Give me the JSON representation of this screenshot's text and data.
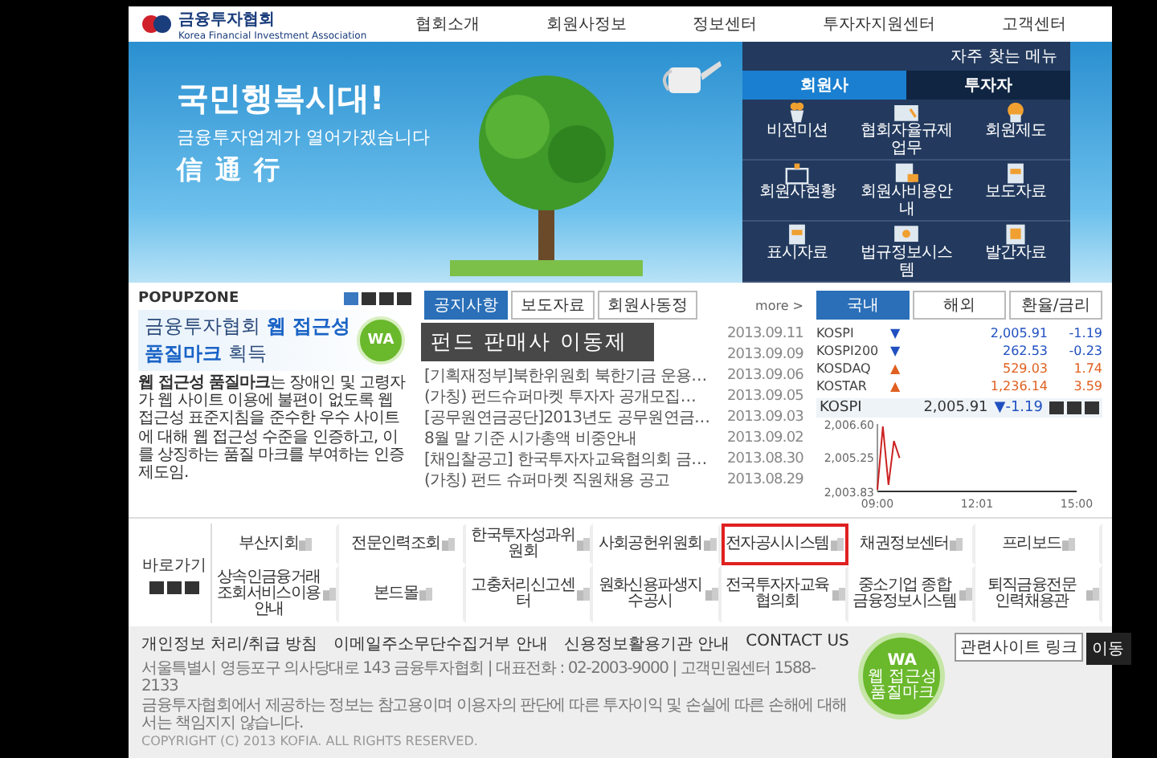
{
  "header": {
    "logo": {
      "name": "금융투자협회",
      "subtitle": "Korea Financial Investment Association"
    },
    "nav": [
      "협회소개",
      "회원사정보",
      "정보센터",
      "투자자지원센터",
      "고객센터"
    ]
  },
  "banner": {
    "headline": "국민행복시대!",
    "subhead": "금융투자업계가 열어가겠습니다",
    "values": [
      "信",
      "通",
      "行"
    ],
    "quick_menu": {
      "title": "자주 찾는 메뉴",
      "tabs": [
        {
          "label": "회원사",
          "selected": true
        },
        {
          "label": "투자자",
          "selected": false
        }
      ],
      "items": [
        {
          "label": "비전미션",
          "kind": "pot"
        },
        {
          "label": "협회자율규제업무",
          "kind": "book"
        },
        {
          "label": "회원제도",
          "kind": "badge"
        },
        {
          "label": "회원사현황",
          "kind": "box"
        },
        {
          "label": "회원사비용안내",
          "kind": "news"
        },
        {
          "label": "보도자료",
          "kind": "file"
        },
        {
          "label": "표시자료",
          "kind": "file"
        },
        {
          "label": "법규정보시스템",
          "kind": "screen"
        },
        {
          "label": "발간자료",
          "kind": "frame"
        }
      ]
    }
  },
  "popup_zone": {
    "title": "POPUPZONE",
    "headline": [
      "금융투자협회 **웹 접근성**",
      "**품질마크** 획득"
    ],
    "badge": "WA",
    "text": "**웹 접근성 품질마크**는 장애인 및 고령자가 웹 사이트 이용에 불편이 없도록 웹 접근성 표준지침을 준수한 우수 사이트에 대해 웹 접근성 수준을 인증하고, 이를 상징하는 품질 마크를 부여하는 인증제도임."
  },
  "notices": {
    "tabs": [
      {
        "label": "공지사항",
        "selected": true
      },
      {
        "label": "보도자료",
        "selected": false
      },
      {
        "label": "회원사동정",
        "selected": false
      }
    ],
    "more": "more >",
    "caption": "펀드 판매사 이동제",
    "items": [
      {
        "date": "2013.09.11"
      },
      {
        "date": "2013.09.09"
      },
      {
        "title": "[기획재정부]북한위원회 북한기금 운용…",
        "date": "2013.09.06"
      },
      {
        "title": "(가칭) 펀드슈퍼마켓 투자자 공개모집…",
        "date": "2013.09.05"
      },
      {
        "title": "[공무원연금공단]2013년도 공무원연금…",
        "date": "2013.09.03"
      },
      {
        "title": "8월 말 기준 시가총액 비중안내",
        "date": "2013.09.02"
      },
      {
        "title": "[채입찰공고] 한국투자자교육협의회 금…",
        "date": "2013.08.30"
      },
      {
        "title": "(가칭) 펀드 슈퍼마켓 직원채용 공고",
        "date": "2013.08.29"
      }
    ]
  },
  "market": {
    "tabs": [
      {
        "label": "국내",
        "selected": true
      },
      {
        "label": "해외",
        "selected": false
      },
      {
        "label": "환율/금리",
        "selected": false
      }
    ],
    "indices": [
      {
        "name": "KOSPI",
        "arrow": "▼",
        "color": "#2050c0",
        "value": "2,005.91",
        "change": "-1.19"
      },
      {
        "name": "KOSPI200",
        "arrow": "▼",
        "color": "#2050c0",
        "value": "262.53",
        "change": "-0.23"
      },
      {
        "name": "KOSDAQ",
        "arrow": "▲",
        "color": "#e06020",
        "value": "529.03",
        "change": "1.74"
      },
      {
        "name": "KOSTAR",
        "arrow": "▲",
        "color": "#e06020",
        "value": "1,236.14",
        "change": "3.59"
      }
    ],
    "chart_value": "2,005.91",
    "chart_change": "▼-1.19",
    "chart_data": {
      "type": "line",
      "title": "KOSPI",
      "categories": [
        "09:00",
        null,
        null,
        null,
        null,
        null,
        null,
        null,
        null,
        null,
        null,
        null,
        null,
        null,
        null,
        null,
        null,
        null,
        "12:01",
        null,
        null,
        null,
        null,
        null,
        null,
        null,
        null,
        null,
        null,
        null,
        null,
        null,
        null,
        null,
        null,
        null,
        "15:00"
      ],
      "ylim": [
        2003.83,
        2006.6
      ],
      "yticks": [
        {
          "value": 2003.83,
          "label": "2,003.83"
        },
        {
          "value": 2005.25,
          "label": "2,005.25"
        },
        {
          "value": 2006.6,
          "label": "2,006.60"
        }
      ],
      "series": [
        {
          "color": "#cc2222",
          "values": [
            2003.9,
            2006.5,
            2004.1,
            2005.9,
            2005.2,
            null,
            null,
            null,
            null,
            null,
            null,
            null,
            null,
            null,
            null,
            null,
            null,
            null,
            null,
            null,
            null,
            null,
            null,
            null,
            null,
            null,
            null,
            null,
            null,
            null,
            null,
            null,
            null,
            null,
            null,
            null,
            null
          ]
        }
      ]
    }
  },
  "quick_links": {
    "title": "바로가기",
    "items": [
      {
        "label": "부산지회",
        "highlighted": false
      },
      {
        "label": "전문인력조회",
        "highlighted": false
      },
      {
        "label": "한국투자성과위원회",
        "highlighted": false
      },
      {
        "label": "사회공헌위원회",
        "highlighted": false
      },
      {
        "label": "전자공시시스템",
        "highlighted": true
      },
      {
        "label": "채권정보센터",
        "highlighted": false
      },
      {
        "label": "프리보드",
        "highlighted": false
      },
      {
        "label": "상속인금융거래 조회서비스이용안내",
        "highlighted": false
      },
      {
        "label": "본드몰",
        "highlighted": false
      },
      {
        "label": "고충처리신고센터",
        "highlighted": false
      },
      {
        "label": "원화신용파생지수공시",
        "highlighted": false
      },
      {
        "label": "전국투자자교육협의회",
        "highlighted": false
      },
      {
        "label": "중소기업 종합 금융정보시스템",
        "highlighted": false
      },
      {
        "label": "퇴직금융전문 인력채용관",
        "highlighted": false
      }
    ]
  },
  "footer": {
    "links": [
      "개인정보 처리/취급 방침",
      "이메일주소무단수집거부 안내",
      "신용정보활용기관 안내",
      "CONTACT US"
    ],
    "address": "서울특별시 영등포구 의사당대로 143 금융투자협회 | 대표전화 : 02-2003-9000 | 고객민원센터 1588-2133",
    "disclaimer": "금융투자협회에서 제공하는 정보는 참고용이며 이용자의 판단에 따른 투자이익 및 손실에 따른 손해에 대해서는 책임지지 않습니다.",
    "copyright": "COPYRIGHT (C) 2013 KOFIA. ALL RIGHTS RESERVED.",
    "badge": {
      "mark": "WA",
      "text": "웹 접근성 품질마크"
    },
    "site_select": "관련사이트 링크",
    "go_button": "이동"
  }
}
